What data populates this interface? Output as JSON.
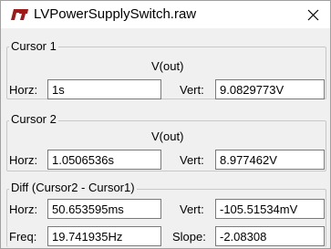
{
  "window": {
    "title": "LVPowerSupplySwitch.raw"
  },
  "cursor1": {
    "title": "Cursor 1",
    "trace": "V(out)",
    "horz_label": "Horz:",
    "horz_value": "1s",
    "vert_label": "Vert:",
    "vert_value": "9.0829773V"
  },
  "cursor2": {
    "title": "Cursor 2",
    "trace": "V(out)",
    "horz_label": "Horz:",
    "horz_value": "1.0506536s",
    "vert_label": "Vert:",
    "vert_value": "8.977462V"
  },
  "diff": {
    "title": "Diff (Cursor2 - Cursor1)",
    "horz_label": "Horz:",
    "horz_value": "50.653595ms",
    "vert_label": "Vert:",
    "vert_value": "-105.51534mV",
    "freq_label": "Freq:",
    "freq_value": "19.741935Hz",
    "slope_label": "Slope:",
    "slope_value": "-2.08308"
  },
  "colors": {
    "icon": "#a01818"
  }
}
